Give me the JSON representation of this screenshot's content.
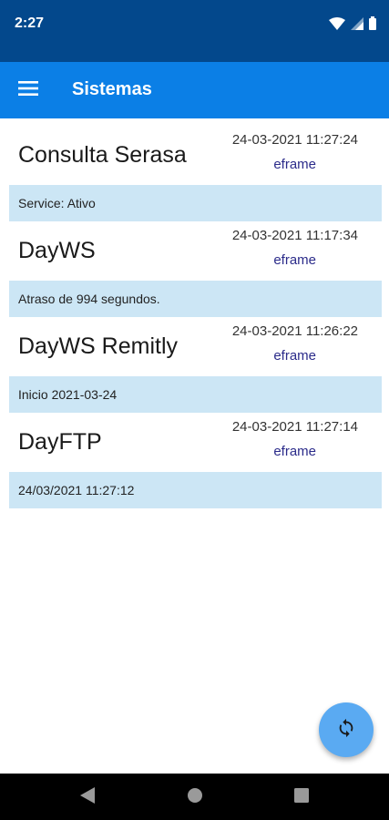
{
  "status_bar": {
    "time": "2:27",
    "icons": [
      "wifi-icon",
      "signal-icon",
      "battery-icon"
    ]
  },
  "app_bar": {
    "title": "Sistemas",
    "menu_icon": "menu-icon"
  },
  "systems": [
    {
      "name": "Consulta Serasa",
      "date": "24-03-2021 11:27:24",
      "user": "eframe",
      "status": "Service: Ativo"
    },
    {
      "name": "DayWS",
      "date": "24-03-2021 11:17:34",
      "user": "eframe",
      "status": "Atraso de 994 segundos."
    },
    {
      "name": "DayWS Remitly",
      "date": "24-03-2021 11:26:22",
      "user": "eframe",
      "status": "Inicio 2021-03-24"
    },
    {
      "name": "DayFTP",
      "date": "24-03-2021 11:27:14",
      "user": "eframe",
      "status": "24/03/2021 11:27:12"
    }
  ],
  "fab": {
    "icon": "refresh-icon"
  },
  "nav_bar": {
    "icons": [
      "back-icon",
      "home-icon",
      "recents-icon"
    ]
  },
  "colors": {
    "status_bar": "#03488c",
    "app_bar": "#0b7fe6",
    "status_row": "#cce6f5",
    "fab": "#5aaaf2"
  }
}
